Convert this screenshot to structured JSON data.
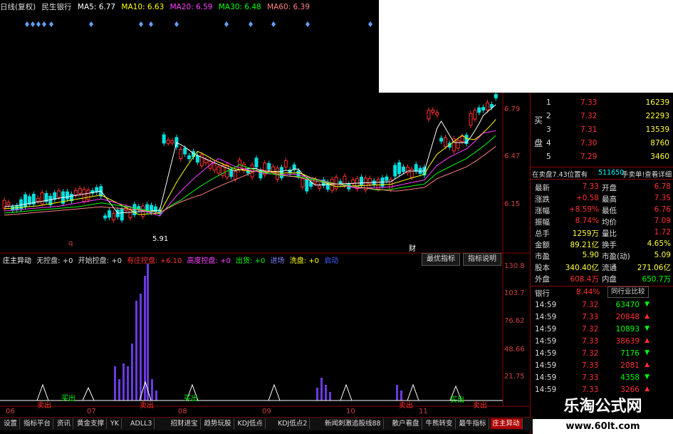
{
  "ma_bar": {
    "label1": "日线(复权)",
    "stock": "民生银行",
    "ma5": "MA5: 6.77",
    "ma10": "MA10: 6.63",
    "ma20": "MA20: 6.59",
    "ma30": "MA30: 6.48",
    "ma60": "MA60: 6.39"
  },
  "price_axis": [
    "6.79",
    "6.47",
    "6.15"
  ],
  "price_marks": {
    "low": "5.91",
    "q": "q",
    "cai": "财"
  },
  "indicator_bar": {
    "name": "庄主异动",
    "i1": "无控盘: +0",
    "i2": "开始控盘: +0",
    "i3": "有庄控盘: +6.10",
    "i4": "高度控盘: +0",
    "i5": "出货: +0",
    "i6": "进场",
    "i7": "洗盘: +0",
    "i8": "启动"
  },
  "buttons": {
    "best": "最优指标",
    "explain": "指标说明"
  },
  "ind_axis": [
    "130.8",
    "103.7",
    "76.62",
    "48.66",
    "21.75"
  ],
  "signals": {
    "buy": "卖出",
    "sell": "买出"
  },
  "x_axis": [
    "06",
    "07",
    "08",
    "09",
    "10",
    "11"
  ],
  "order_book": [
    {
      "n": "1",
      "p": "7.33",
      "v": "16239"
    },
    {
      "n": "2",
      "p": "7.32",
      "v": "22293"
    },
    {
      "n": "3",
      "p": "7.31",
      "v": "13539"
    },
    {
      "n": "4",
      "p": "7.30",
      "v": "8760"
    },
    {
      "n": "5",
      "p": "7.29",
      "v": "3460"
    }
  ],
  "order_book_label": [
    "买",
    "盘"
  ],
  "sell_info": {
    "text1": "在卖盘7.43位置有",
    "qty": "511650",
    "text2": "手卖单!查看详细"
  },
  "quote": [
    {
      "l": "最新",
      "v": "7.33",
      "l2": "开盘",
      "v2": "6.78"
    },
    {
      "l": "涨跌",
      "v": "+0.58",
      "l2": "最高",
      "v2": "7.35"
    },
    {
      "l": "涨幅",
      "v": "+8.59%",
      "l2": "最低",
      "v2": "6.76"
    },
    {
      "l": "振幅",
      "v": "8.74%",
      "l2": "均价",
      "v2": "7.09"
    },
    {
      "l": "总手",
      "v": "1259万",
      "l2": "量比",
      "v2": "1.72"
    },
    {
      "l": "金额",
      "v": "89.21亿",
      "l2": "换手",
      "v2": "4.65%"
    },
    {
      "l": "市盈",
      "v": "5.90",
      "l2": "市盈(动)",
      "v2": "5.09"
    },
    {
      "l": "股本",
      "v": "340.40亿",
      "l2": "流通",
      "v2": "271.06亿"
    },
    {
      "l": "外盘",
      "v": "608.4万",
      "l2": "内盘",
      "v2": "650.7万"
    }
  ],
  "sector": {
    "name": "银行",
    "pct": "8.44%",
    "btn": "同行业比较"
  },
  "ticks": [
    {
      "t": "14:59",
      "p": "7.32",
      "v": "63470"
    },
    {
      "t": "14:59",
      "p": "7.33",
      "v": "20848"
    },
    {
      "t": "14:59",
      "p": "7.32",
      "v": "10893"
    },
    {
      "t": "14:59",
      "p": "7.33",
      "v": "38639"
    },
    {
      "t": "14:59",
      "p": "7.32",
      "v": "7176"
    },
    {
      "t": "14:59",
      "p": "7.33",
      "v": "2081"
    },
    {
      "t": "14:59",
      "p": "7.33",
      "v": "4358"
    },
    {
      "t": "14:59",
      "p": "7.33",
      "v": "3266"
    }
  ],
  "tabs": [
    "设置",
    "指标平台",
    "资讯",
    "黄金支撑",
    "YK",
    "ADLL3",
    "招财进宝",
    "趋势玩股",
    "KDJ低点",
    "KDJ低点2",
    "新闻刺激追股线88",
    "散户看盘",
    "牛熊转变",
    "最牛指标",
    "庄主异动"
  ],
  "watermark": {
    "line1": "乐淘公式网",
    "line2": "www.60lt.com"
  },
  "colors": {
    "up": "#ff3030",
    "down": "#00e0e0",
    "bg": "#000000",
    "ma5": "#ffffff",
    "ma10": "#ffff00",
    "ma20": "#ff40ff",
    "ma30": "#00ff00",
    "ma60": "#ff8080"
  }
}
